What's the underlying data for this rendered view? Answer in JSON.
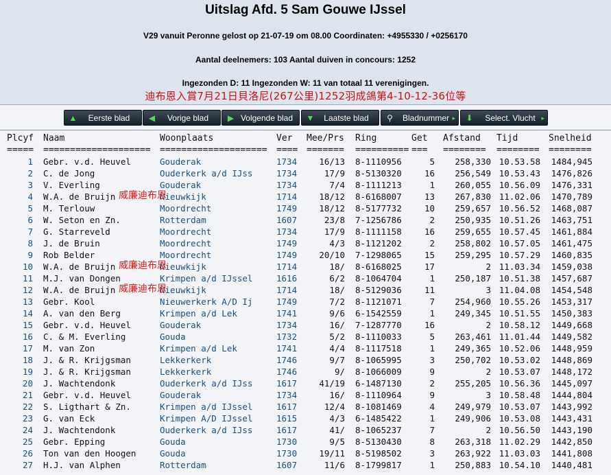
{
  "header": {
    "title": "Uitslag Afd. 5 Sam Gouwe IJssel",
    "info1": "V29 vanuit Peronne gelost op 21-07-19 om 08.00 Coordinaten: +4955330 / +0256170",
    "info2": "Aantal deelnemers: 103 Aantal duiven in concours: 1252",
    "info3": "Ingezonden D: 11 Ingezonden W: 11 van totaal 11 verenigingen.",
    "banner": "迪布恩入賞7月21日貝洛尼(267公里)1252羽成鴿第4-10-12-36位等"
  },
  "nav": [
    {
      "label": "Eerste blad",
      "icon": "arrow-up-icon"
    },
    {
      "label": "Vorige blad",
      "icon": "arrow-left-icon"
    },
    {
      "label": "Volgende blad",
      "icon": "arrow-right-icon"
    },
    {
      "label": "Laatste blad",
      "icon": "arrow-down-icon"
    },
    {
      "label": "Bladnummer",
      "icon": "search-icon"
    },
    {
      "label": "Select. Vlucht",
      "icon": "download-icon"
    }
  ],
  "table": {
    "headers": [
      "Plcyf",
      "Naam",
      "Woonplaats",
      "Ver",
      "Mee/Prs",
      "Ring",
      "Get",
      "Afstand",
      "Tijd",
      "Snelheid"
    ],
    "separators": [
      "=====",
      "====================",
      "====================",
      "====",
      "=======",
      "==========",
      "===",
      "========",
      "========",
      "========"
    ],
    "overlay_text": "威廉迪布恩",
    "rows": [
      {
        "plc": "1",
        "naam": "Gebr. v.d. Heuvel",
        "woon": "Gouderak",
        "ver": "1734",
        "mee": "16/13",
        "ring": "8-1110956",
        "get": "5",
        "afst": "258,330",
        "tijd": "10.53.58",
        "snel": "1484,945"
      },
      {
        "plc": "2",
        "naam": "C. de Jong",
        "woon": "Ouderkerk a/d IJss",
        "ver": "1734",
        "mee": "17/9",
        "ring": "8-5130320",
        "get": "16",
        "afst": "256,549",
        "tijd": "10.53.43",
        "snel": "1476,826"
      },
      {
        "plc": "3",
        "naam": "V. Everling",
        "woon": "Gouderak",
        "ver": "1734",
        "mee": "7/4",
        "ring": "8-1111213",
        "get": "1",
        "afst": "260,055",
        "tijd": "10.56.09",
        "snel": "1476,331"
      },
      {
        "plc": "4",
        "naam": "W.A. de Bruijn",
        "woon": "Nieuwkijk",
        "ver": "1714",
        "mee": "18/12",
        "ring": "8-6168007",
        "get": "13",
        "afst": "267,830",
        "tijd": "11.02.06",
        "snel": "1470,789",
        "ov": true
      },
      {
        "plc": "5",
        "naam": "M. Terlouw",
        "woon": "Moordrecht",
        "ver": "1749",
        "mee": "18/12",
        "ring": "8-5177732",
        "get": "10",
        "afst": "259,657",
        "tijd": "10.56.52",
        "snel": "1468,087"
      },
      {
        "plc": "6",
        "naam": "W. Seton en Zn.",
        "woon": "Rotterdam",
        "ver": "1607",
        "mee": "23/8",
        "ring": "7-1256786",
        "get": "2",
        "afst": "250,935",
        "tijd": "10.51.26",
        "snel": "1463,751"
      },
      {
        "plc": "7",
        "naam": "G. Starreveld",
        "woon": "Moordrecht",
        "ver": "1734",
        "mee": "17/9",
        "ring": "8-1111158",
        "get": "16",
        "afst": "259,655",
        "tijd": "10.57.45",
        "snel": "1461,884"
      },
      {
        "plc": "8",
        "naam": "J. de Bruin",
        "woon": "Moordrecht",
        "ver": "1749",
        "mee": "4/3",
        "ring": "8-1121202",
        "get": "2",
        "afst": "258,802",
        "tijd": "10.57.05",
        "snel": "1461,475"
      },
      {
        "plc": "9",
        "naam": "Rob Belder",
        "woon": "Moordrecht",
        "ver": "1749",
        "mee": "20/10",
        "ring": "7-1298065",
        "get": "15",
        "afst": "259,295",
        "tijd": "10.57.29",
        "snel": "1460,835"
      },
      {
        "plc": "10",
        "naam": "W.A. de Bruijn",
        "woon": "Nieuwkijk",
        "ver": "1714",
        "mee": "18/",
        "ring": "8-6168025",
        "get": "17",
        "afst": "2",
        "tijd": "11.03.34",
        "snel": "1459,038",
        "ov": true
      },
      {
        "plc": "11",
        "naam": "M.J. van Dongen",
        "woon": "Krimpen a/d IJssel",
        "ver": "1616",
        "mee": "6/2",
        "ring": "8-1064704",
        "get": "1",
        "afst": "250,187",
        "tijd": "10.51.38",
        "snel": "1457,687"
      },
      {
        "plc": "12",
        "naam": "W.A. de Bruijn",
        "woon": "Nieuwkijk",
        "ver": "1714",
        "mee": "18/",
        "ring": "8-5129036",
        "get": "11",
        "afst": "3",
        "tijd": "11.04.08",
        "snel": "1454,548",
        "ov": true
      },
      {
        "plc": "13",
        "naam": "Gebr. Kool",
        "woon": "Nieuwerkerk A/D Ij",
        "ver": "1749",
        "mee": "7/2",
        "ring": "8-1121071",
        "get": "7",
        "afst": "254,960",
        "tijd": "10.55.26",
        "snel": "1453,317"
      },
      {
        "plc": "14",
        "naam": "A. van den Berg",
        "woon": "Krimpen a/d Lek",
        "ver": "1741",
        "mee": "9/6",
        "ring": "6-1542559",
        "get": "1",
        "afst": "249,345",
        "tijd": "10.51.55",
        "snel": "1450,383"
      },
      {
        "plc": "15",
        "naam": "Gebr. v.d. Heuvel",
        "woon": "Gouderak",
        "ver": "1734",
        "mee": "16/",
        "ring": "7-1287770",
        "get": "16",
        "afst": "2",
        "tijd": "10.58.12",
        "snel": "1449,668"
      },
      {
        "plc": "16",
        "naam": "C. & M. Everling",
        "woon": "Gouda",
        "ver": "1732",
        "mee": "5/2",
        "ring": "8-1110033",
        "get": "5",
        "afst": "263,461",
        "tijd": "11.01.44",
        "snel": "1449,582"
      },
      {
        "plc": "17",
        "naam": "M. van Zon",
        "woon": "Krimpen a/d Lek",
        "ver": "1741",
        "mee": "4/4",
        "ring": "8-1117518",
        "get": "1",
        "afst": "249,365",
        "tijd": "10.52.06",
        "snel": "1448,959"
      },
      {
        "plc": "18",
        "naam": "J. & R. Krijgsman",
        "woon": "Lekkerkerk",
        "ver": "1746",
        "mee": "9/7",
        "ring": "8-1065995",
        "get": "3",
        "afst": "250,702",
        "tijd": "10.53.02",
        "snel": "1448,869"
      },
      {
        "plc": "19",
        "naam": "J. & R. Krijgsman",
        "woon": "Lekkerkerk",
        "ver": "1746",
        "mee": "9/",
        "ring": "8-1066009",
        "get": "9",
        "afst": "2",
        "tijd": "10.53.07",
        "snel": "1448,172"
      },
      {
        "plc": "20",
        "naam": "J. Wachtendonk",
        "woon": "Ouderkerk a/d IJss",
        "ver": "1617",
        "mee": "41/19",
        "ring": "6-1487130",
        "get": "2",
        "afst": "255,205",
        "tijd": "10.56.36",
        "snel": "1445,097"
      },
      {
        "plc": "21",
        "naam": "Gebr. v.d. Heuvel",
        "woon": "Gouderak",
        "ver": "1734",
        "mee": "16/",
        "ring": "8-1110964",
        "get": "9",
        "afst": "3",
        "tijd": "10.58.48",
        "snel": "1444,804"
      },
      {
        "plc": "22",
        "naam": "S. Ligthart & Zn.",
        "woon": "Krimpen a/d IJssel",
        "ver": "1617",
        "mee": "12/4",
        "ring": "8-1081469",
        "get": "4",
        "afst": "249,979",
        "tijd": "10.53.07",
        "snel": "1443,992"
      },
      {
        "plc": "23",
        "naam": "G. van Eck",
        "woon": "Krimpen A/D IJssel",
        "ver": "1615",
        "mee": "4/3",
        "ring": "6-1485422",
        "get": "1",
        "afst": "249,906",
        "tijd": "10.53.08",
        "snel": "1443,431"
      },
      {
        "plc": "24",
        "naam": "J. Wachtendonk",
        "woon": "Ouderkerk a/d IJss",
        "ver": "1617",
        "mee": "41/",
        "ring": "8-1065237",
        "get": "7",
        "afst": "2",
        "tijd": "10.56.50",
        "snel": "1443,190"
      },
      {
        "plc": "25",
        "naam": "Gebr. Epping",
        "woon": "Gouda",
        "ver": "1730",
        "mee": "9/5",
        "ring": "8-5130430",
        "get": "8",
        "afst": "263,318",
        "tijd": "11.02.29",
        "snel": "1442,850"
      },
      {
        "plc": "26",
        "naam": "Ton van den Hoogen",
        "woon": "Gouda",
        "ver": "1730",
        "mee": "19/11",
        "ring": "8-5198502",
        "get": "3",
        "afst": "263,922",
        "tijd": "11.03.03",
        "snel": "1441,808"
      },
      {
        "plc": "27",
        "naam": "H.J. van Alphen",
        "woon": "Rotterdam",
        "ver": "1607",
        "mee": "11/6",
        "ring": "8-1799817",
        "get": "1",
        "afst": "250,883",
        "tijd": "10.54.10",
        "snel": "1440,481"
      }
    ]
  }
}
